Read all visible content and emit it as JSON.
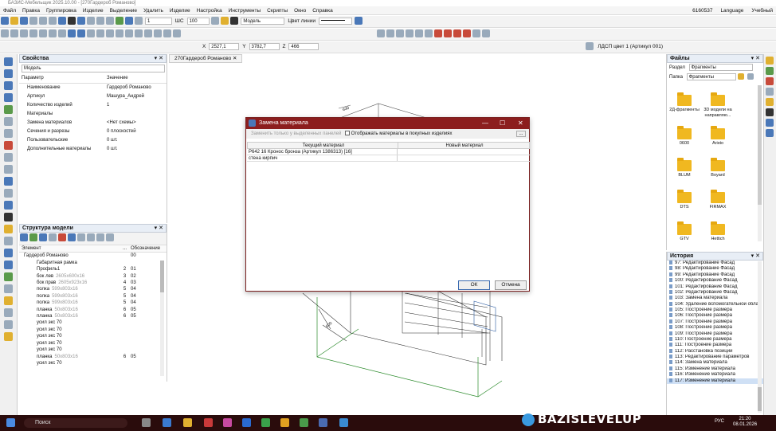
{
  "window": {
    "title": "БАЗИС-Мебельщик 2025.10.00 - [270Гардероб Романово]"
  },
  "menu": [
    "Файл",
    "Правка",
    "Группировка",
    "Изделие",
    "Выделение",
    "Удалить",
    "Изделие",
    "Настройка",
    "Инструменты",
    "Скрипты",
    "Окно",
    "Справка"
  ],
  "menu_right": {
    "code": "6160537",
    "language": "Language",
    "mode": "Учебный"
  },
  "toolbar": {
    "scale_value": "1",
    "step_label": "ШС",
    "step_value": "100",
    "view_mode": "Модель",
    "line_color_label": "Цвет линии",
    "x_label": "X",
    "x_value": "2527,1",
    "y_label": "Y",
    "y_value": "3782,7",
    "z_label": "Z",
    "z_value": "466",
    "material_label": "ЛДСП цвет 1 (Артикул 001)"
  },
  "properties": {
    "title": "Свойства",
    "selector": "Модель",
    "col_param": "Параметр",
    "col_value": "Значение",
    "rows": [
      {
        "k": "Наименование",
        "v": "Гардероб Романово"
      },
      {
        "k": "Артикул",
        "v": "Машура_Андрей"
      },
      {
        "k": "Количество изделий",
        "v": "1"
      },
      {
        "k": "Материалы",
        "v": ""
      },
      {
        "k": "Замена материалов",
        "v": "<Нет схемы>"
      },
      {
        "k": "Сечения и разрезы",
        "v": "0 плоскостей"
      },
      {
        "k": "Пользовательские",
        "v": "0 шт."
      },
      {
        "k": "Дополнительные материалы",
        "v": "0 шт."
      }
    ]
  },
  "structure": {
    "title": "Структура модели",
    "col_element": "Элемент",
    "col_qty": "...",
    "col_designation": "Обозначение",
    "rows": [
      {
        "n": "Гардероб Романово",
        "dim": "",
        "q": "",
        "d": "00"
      },
      {
        "n": "Габаритная рамка",
        "dim": "",
        "q": "",
        "d": ""
      },
      {
        "n": "Профиль1",
        "dim": "",
        "q": "2",
        "d": "01"
      },
      {
        "n": "бок лев",
        "dim": "2605x600x16",
        "q": "3",
        "d": "02"
      },
      {
        "n": "бок прав",
        "dim": "2605x923x16",
        "q": "4",
        "d": "03"
      },
      {
        "n": "полка",
        "dim": "599x803x16",
        "q": "5",
        "d": "04"
      },
      {
        "n": "полка",
        "dim": "599x803x16",
        "q": "5",
        "d": "04"
      },
      {
        "n": "полка",
        "dim": "599x803x16",
        "q": "5",
        "d": "04"
      },
      {
        "n": "планка",
        "dim": "50x803x16",
        "q": "6",
        "d": "05"
      },
      {
        "n": "планка",
        "dim": "50x803x16",
        "q": "6",
        "d": "05"
      },
      {
        "n": "усил экс 70",
        "dim": "",
        "q": "",
        "d": ""
      },
      {
        "n": "усил экс 70",
        "dim": "",
        "q": "",
        "d": ""
      },
      {
        "n": "усил экс 70",
        "dim": "",
        "q": "",
        "d": ""
      },
      {
        "n": "усил экс 70",
        "dim": "",
        "q": "",
        "d": ""
      },
      {
        "n": "усил экс 70",
        "dim": "",
        "q": "",
        "d": ""
      },
      {
        "n": "планка",
        "dim": "50x803x16",
        "q": "6",
        "d": "05"
      },
      {
        "n": "усил экс 70",
        "dim": "",
        "q": "",
        "d": ""
      }
    ]
  },
  "tab": {
    "label": "270Гардероб Романово"
  },
  "dialog": {
    "title": "Замена материала",
    "opt_selected": "Заменить только у выделенных панелей",
    "opt_purchased": "Отображать материалы в покупных изделиях",
    "browse": "...",
    "col_current": "Текущий материал",
    "col_new": "Новый материал",
    "rows": [
      {
        "current": "Р642 16 Кронос бронза (Артикул 1386313) [16]",
        "new": ""
      },
      {
        "current": "стена кирпич",
        "new": ""
      }
    ],
    "ok": "ОК",
    "cancel": "Отмена"
  },
  "files": {
    "title": "Файлы",
    "section_label": "Раздел",
    "section_value": "Фрагменты",
    "folder_label": "Папка",
    "folder_value": "Фрагменты",
    "folders": [
      "2Д-фрагменты",
      "3D модели на направляю...",
      "0600",
      "Aristo",
      "BLUM",
      "Boyard",
      "DTS",
      "FIRMAX",
      "GTV",
      "Hettich"
    ]
  },
  "history": {
    "title": "История",
    "rows": [
      "97: Редактирование Фасад",
      "98: Редактирование Фасад",
      "99: Редактирование Фасад",
      "100: Редактирование Фасад",
      "101: Редактирование Фасад",
      "102: Редактирование Фасад",
      "103: Замена материала",
      "104: Удаление вспомогательной обла",
      "105: Построение размера",
      "106: Построение размера",
      "107: Построение размера",
      "108: Построение размера",
      "109: Построение размера",
      "110: Построение размера",
      "111: Построение размера",
      "112: Расстановка позиций",
      "113: Редактирование параметров",
      "114: Замена материала",
      "115: Изменение материала",
      "116: Изменение материала",
      "117: Изменение материала"
    ]
  },
  "dims": [
    "630",
    "600"
  ],
  "taskbar": {
    "search": "Поиск",
    "lang": "РУС",
    "time": "21:20",
    "date": "08.01.2026"
  },
  "brand": "BAZISLEVELUP"
}
